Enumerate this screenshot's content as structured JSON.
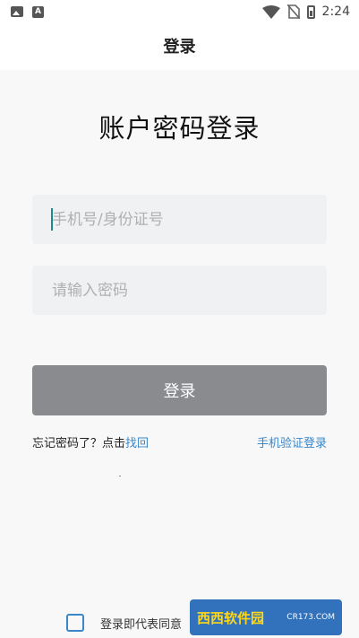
{
  "status_bar": {
    "time": "2:24",
    "left_icons": [
      "image-icon",
      "text-a-icon"
    ],
    "right_icons": [
      "wifi-icon",
      "no-sim-icon",
      "battery-icon"
    ]
  },
  "header": {
    "title": "登录"
  },
  "main": {
    "heading": "账户密码登录",
    "phone_placeholder": "手机号/身份证号",
    "password_placeholder": "请输入密码",
    "login_label": "登录",
    "forgot_text": "忘记密码了？点击",
    "forgot_link": "找回",
    "sms_login": "手机验证登录"
  },
  "footer": {
    "agree_text": "登录即代表同意"
  },
  "watermark": {
    "title": "西西软件园",
    "sub": "CR173.COM"
  },
  "colors": {
    "accent": "#3a86c8",
    "button": "#8a8b8f",
    "input_bg": "#f0f1f3",
    "background": "#f8f8f8"
  }
}
